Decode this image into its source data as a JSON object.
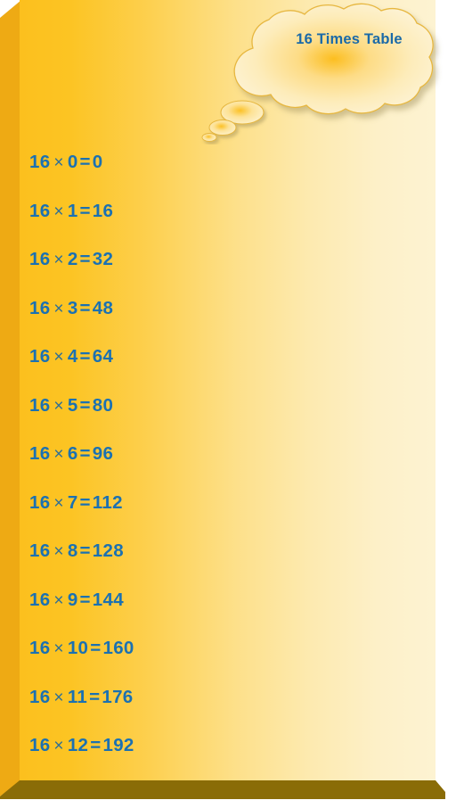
{
  "card": {
    "title": "16 Times Table",
    "colors": {
      "gradient_start": "#fcc01e",
      "gradient_end": "#fdf3d2",
      "text_blue": "#1b71b2",
      "title_blue": "#1b6aa8",
      "bevel_left": "#eeaa14",
      "bevel_bottom": "#8a6c07",
      "bubble_fill": "#fdf0c4",
      "bubble_stroke": "#e8b63c"
    }
  },
  "equations": [
    {
      "left": "16",
      "op": "×",
      "right": "0",
      "eq": "=",
      "product": "0"
    },
    {
      "left": "16",
      "op": "×",
      "right": "1",
      "eq": "=",
      "product": "16"
    },
    {
      "left": "16",
      "op": "×",
      "right": "2",
      "eq": "=",
      "product": "32"
    },
    {
      "left": "16",
      "op": "×",
      "right": "3",
      "eq": "=",
      "product": "48"
    },
    {
      "left": "16",
      "op": "×",
      "right": "4",
      "eq": "=",
      "product": "64"
    },
    {
      "left": "16",
      "op": "×",
      "right": "5",
      "eq": "=",
      "product": "80"
    },
    {
      "left": "16",
      "op": "×",
      "right": "6",
      "eq": "=",
      "product": "96"
    },
    {
      "left": "16",
      "op": "×",
      "right": "7",
      "eq": "=",
      "product": "112"
    },
    {
      "left": "16",
      "op": "×",
      "right": "8",
      "eq": "=",
      "product": "128"
    },
    {
      "left": "16",
      "op": "×",
      "right": "9",
      "eq": "=",
      "product": "144"
    },
    {
      "left": "16",
      "op": "×",
      "right": "10",
      "eq": "=",
      "product": "160"
    },
    {
      "left": "16",
      "op": "×",
      "right": "11",
      "eq": "=",
      "product": "176"
    },
    {
      "left": "16",
      "op": "×",
      "right": "12",
      "eq": "=",
      "product": "192"
    }
  ]
}
